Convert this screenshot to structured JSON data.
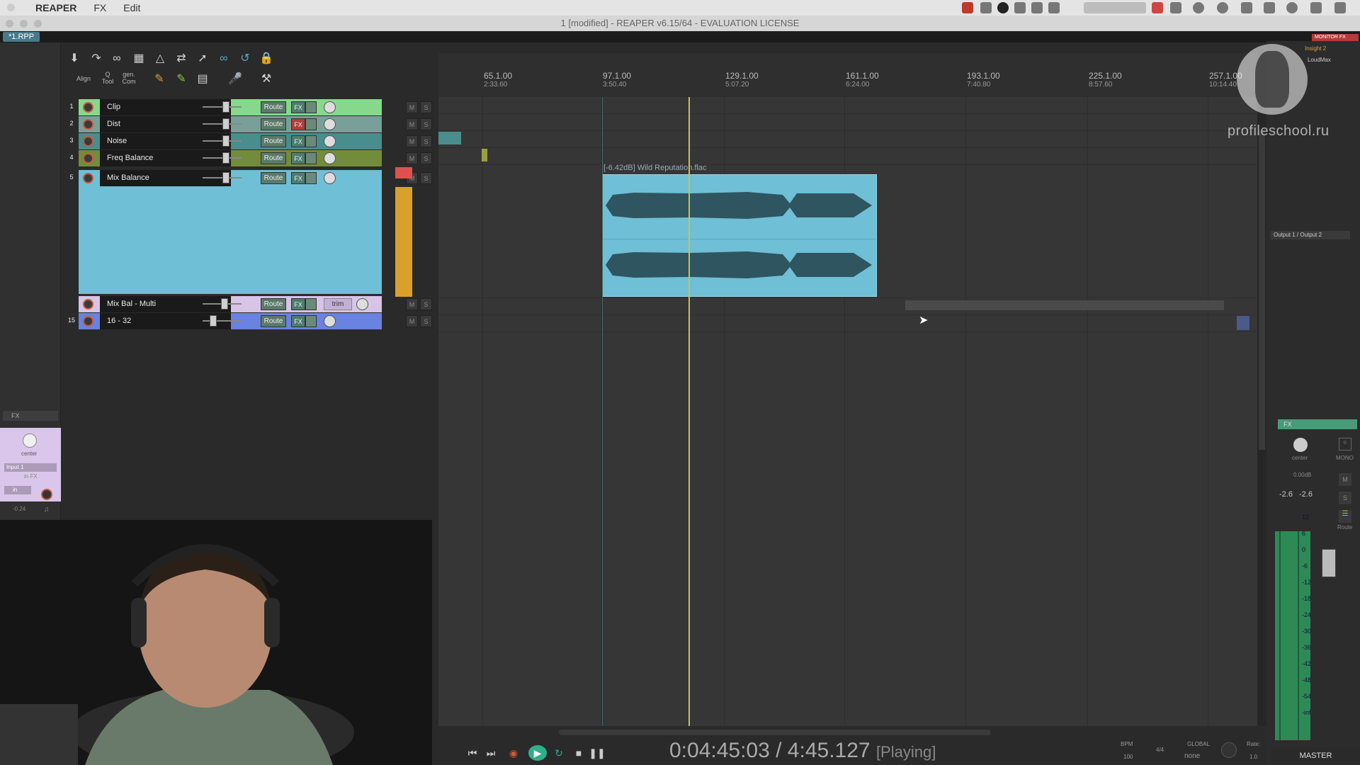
{
  "menubar": {
    "apple": "",
    "app": "REAPER",
    "fx": "FX",
    "edit": "Edit"
  },
  "titlebar": {
    "title": "1 [modified] - REAPER v6.15/64 - EVALUATION LICENSE"
  },
  "project_tab": {
    "label": "*1.RPP"
  },
  "toolbar": {
    "align_label": "Align",
    "qtool_label": "Q Tool",
    "gencom_label": "gen. Com"
  },
  "tracks": [
    {
      "num": "1",
      "name": "Clip",
      "color": "#86d98a",
      "fx_red": false,
      "route": "Route",
      "fx": "FX"
    },
    {
      "num": "2",
      "name": "Dist",
      "color": "#78a098",
      "fx_red": true,
      "route": "Route",
      "fx": "FX"
    },
    {
      "num": "3",
      "name": "Noise",
      "color": "#4a8d8d",
      "fx_red": false,
      "route": "Route",
      "fx": "FX"
    },
    {
      "num": "4",
      "name": "Freq Balance",
      "color": "#738c3c",
      "fx_red": false,
      "route": "Route",
      "fx": "FX"
    },
    {
      "num": "5",
      "name": "Mix Balance",
      "color": "#6fbfd6",
      "fx_red": false,
      "route": "Route",
      "fx": "FX"
    },
    {
      "num": "",
      "name": "Mix Bal - Multi",
      "color": "#d7c4e6",
      "fx_red": false,
      "route": "Route",
      "fx": "FX",
      "trim": "trim"
    },
    {
      "num": "15",
      "name": "16 - 32",
      "color": "#6a82e0",
      "fx_red": false,
      "route": "Route",
      "fx": "FX"
    }
  ],
  "ms": {
    "m": "M",
    "s": "S"
  },
  "ruler": [
    {
      "bar": "65.1.00",
      "time": "2:33.60"
    },
    {
      "bar": "97.1.00",
      "time": "3:50.40"
    },
    {
      "bar": "129.1.00",
      "time": "5:07.20"
    },
    {
      "bar": "161.1.00",
      "time": "6:24.00"
    },
    {
      "bar": "193.1.00",
      "time": "7:40.80"
    },
    {
      "bar": "225.1.00",
      "time": "8:57.60"
    },
    {
      "bar": "257.1.00",
      "time": "10:14.40"
    }
  ],
  "item": {
    "label": "[-6.42dB] Wild Reputation.flac"
  },
  "transport": {
    "time": "0:04:45:03 / 4:45.127",
    "state": "[Playing]",
    "bpm_label": "BPM",
    "bpm": "100",
    "sig": "4/4",
    "global": "GLOBAL",
    "none": "none",
    "rate_label": "Rate:",
    "rate": "1.0"
  },
  "left_mini": {
    "fx": "FX",
    "center": "center",
    "input": "Input 1",
    "infx": "in FX",
    "in": "in",
    "val": "-0.24"
  },
  "master": {
    "monitor_fx": "MONITOR FX",
    "plugins": [
      "Insight 2",
      "LoudMax"
    ],
    "output": "Output 1 / Output 2",
    "fx": "FX",
    "center": "center",
    "mono": "MONO",
    "db": "0.00dB",
    "peak_l": "-2.6",
    "peak_r": "-2.6",
    "route": "Route",
    "name": "MASTER",
    "scale": [
      "12",
      "6",
      "0",
      "-6",
      "-12",
      "-18",
      "-24",
      "-30",
      "-36",
      "-42",
      "-48",
      "-54",
      "-inf"
    ]
  },
  "watermark": {
    "text": "profileschool.ru"
  }
}
